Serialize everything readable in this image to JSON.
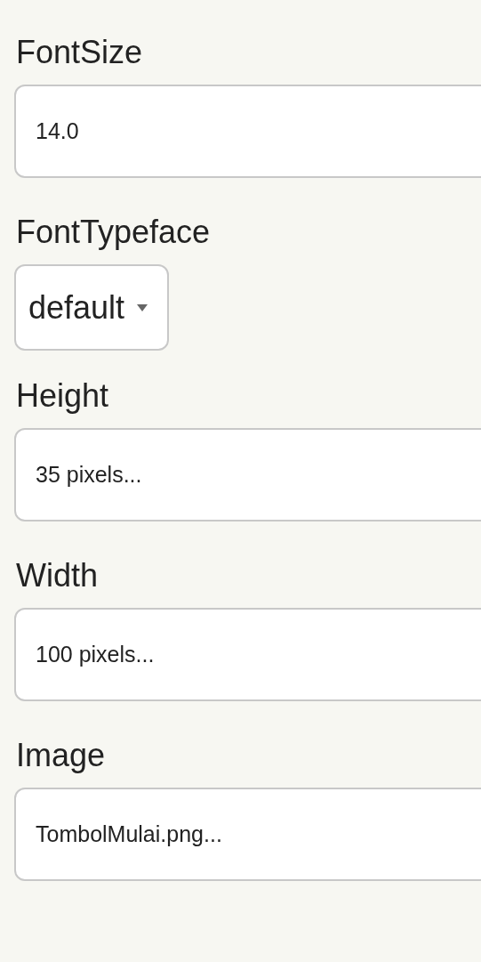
{
  "properties": [
    {
      "label": "FontSize",
      "kind": "textbox",
      "value": "14.0"
    },
    {
      "label": "FontTypeface",
      "kind": "dropdown",
      "value": "default"
    },
    {
      "label": "Height",
      "kind": "picker",
      "value": "35 pixels..."
    },
    {
      "label": "Width",
      "kind": "picker",
      "value": "100 pixels..."
    },
    {
      "label": "Image",
      "kind": "picker",
      "value": "TombolMulai.png..."
    }
  ]
}
